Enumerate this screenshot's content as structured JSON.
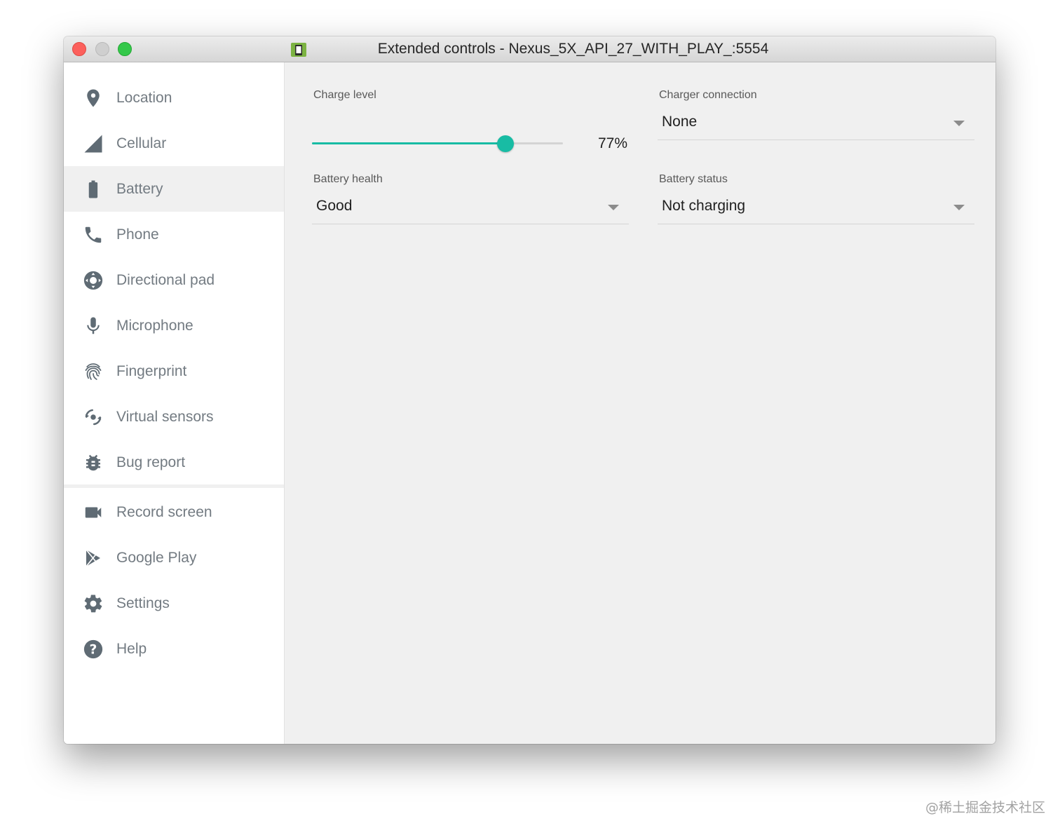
{
  "window": {
    "title": "Extended controls - Nexus_5X_API_27_WITH_PLAY_:5554"
  },
  "sidebar": {
    "items": [
      {
        "label": "Location",
        "icon": "location-pin-icon"
      },
      {
        "label": "Cellular",
        "icon": "cellular-signal-icon"
      },
      {
        "label": "Battery",
        "icon": "battery-icon",
        "selected": true
      },
      {
        "label": "Phone",
        "icon": "phone-icon"
      },
      {
        "label": "Directional pad",
        "icon": "directional-pad-icon"
      },
      {
        "label": "Microphone",
        "icon": "microphone-icon"
      },
      {
        "label": "Fingerprint",
        "icon": "fingerprint-icon"
      },
      {
        "label": "Virtual sensors",
        "icon": "virtual-sensors-icon"
      },
      {
        "label": "Bug report",
        "icon": "bug-icon"
      },
      {
        "label": "Record screen",
        "icon": "video-camera-icon"
      },
      {
        "label": "Google Play",
        "icon": "google-play-icon"
      },
      {
        "label": "Settings",
        "icon": "gear-icon"
      },
      {
        "label": "Help",
        "icon": "help-icon"
      }
    ]
  },
  "battery": {
    "charge_level": {
      "label": "Charge level",
      "value": 77,
      "display": "77%"
    },
    "charger_connection": {
      "label": "Charger connection",
      "value": "None"
    },
    "battery_health": {
      "label": "Battery health",
      "value": "Good"
    },
    "battery_status": {
      "label": "Battery status",
      "value": "Not charging"
    }
  },
  "colors": {
    "accent": "#18bca4",
    "sidebar_text": "#737b82",
    "icon": "#5f6b74"
  },
  "watermark": "@稀土掘金技术社区"
}
